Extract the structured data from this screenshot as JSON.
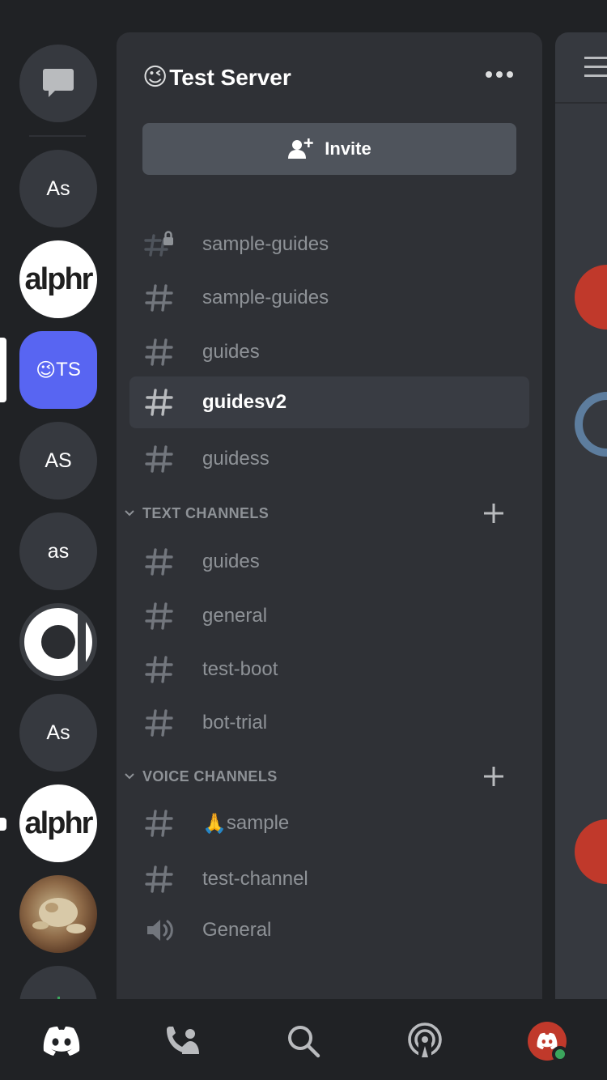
{
  "rail": {
    "dm_label": "Direct Messages",
    "servers": [
      {
        "label": "As"
      },
      {
        "label": "alphr"
      },
      {
        "label": "TS",
        "emoji": "😉"
      },
      {
        "label": "AS"
      },
      {
        "label": "as"
      },
      {
        "label": ""
      },
      {
        "label": "As"
      },
      {
        "label": "alphr"
      },
      {
        "label": ""
      }
    ]
  },
  "server": {
    "emoji": "😉",
    "name": "Test Server",
    "invite_label": "Invite"
  },
  "channels_top": [
    {
      "name": "sample-guides",
      "icon": "locked-hash-icon"
    },
    {
      "name": "sample-guides",
      "icon": "hash-icon"
    },
    {
      "name": "guides",
      "icon": "hash-icon"
    },
    {
      "name": "guidesv2",
      "icon": "hash-icon",
      "active": true
    },
    {
      "name": "guidess",
      "icon": "hash-icon"
    }
  ],
  "categories": {
    "text": {
      "label": "TEXT CHANNELS",
      "channels": [
        "guides",
        "general",
        "test-boot",
        "bot-trial"
      ]
    },
    "voice": {
      "label": "VOICE CHANNELS",
      "channels": [
        {
          "emoji": "🙏",
          "name": "sample",
          "icon": "hash-icon"
        },
        {
          "name": "test-channel",
          "icon": "hash-icon"
        },
        {
          "name": "General",
          "icon": "speaker-icon"
        }
      ]
    }
  },
  "tabbar": [
    "home-tab",
    "friends-tab",
    "search-tab",
    "mentions-tab",
    "profile-tab"
  ],
  "colors": {
    "blurple": "#5865f2",
    "panel": "#2f3136",
    "rail": "#202225",
    "active_row": "#393c43",
    "online": "#3ba55c"
  }
}
